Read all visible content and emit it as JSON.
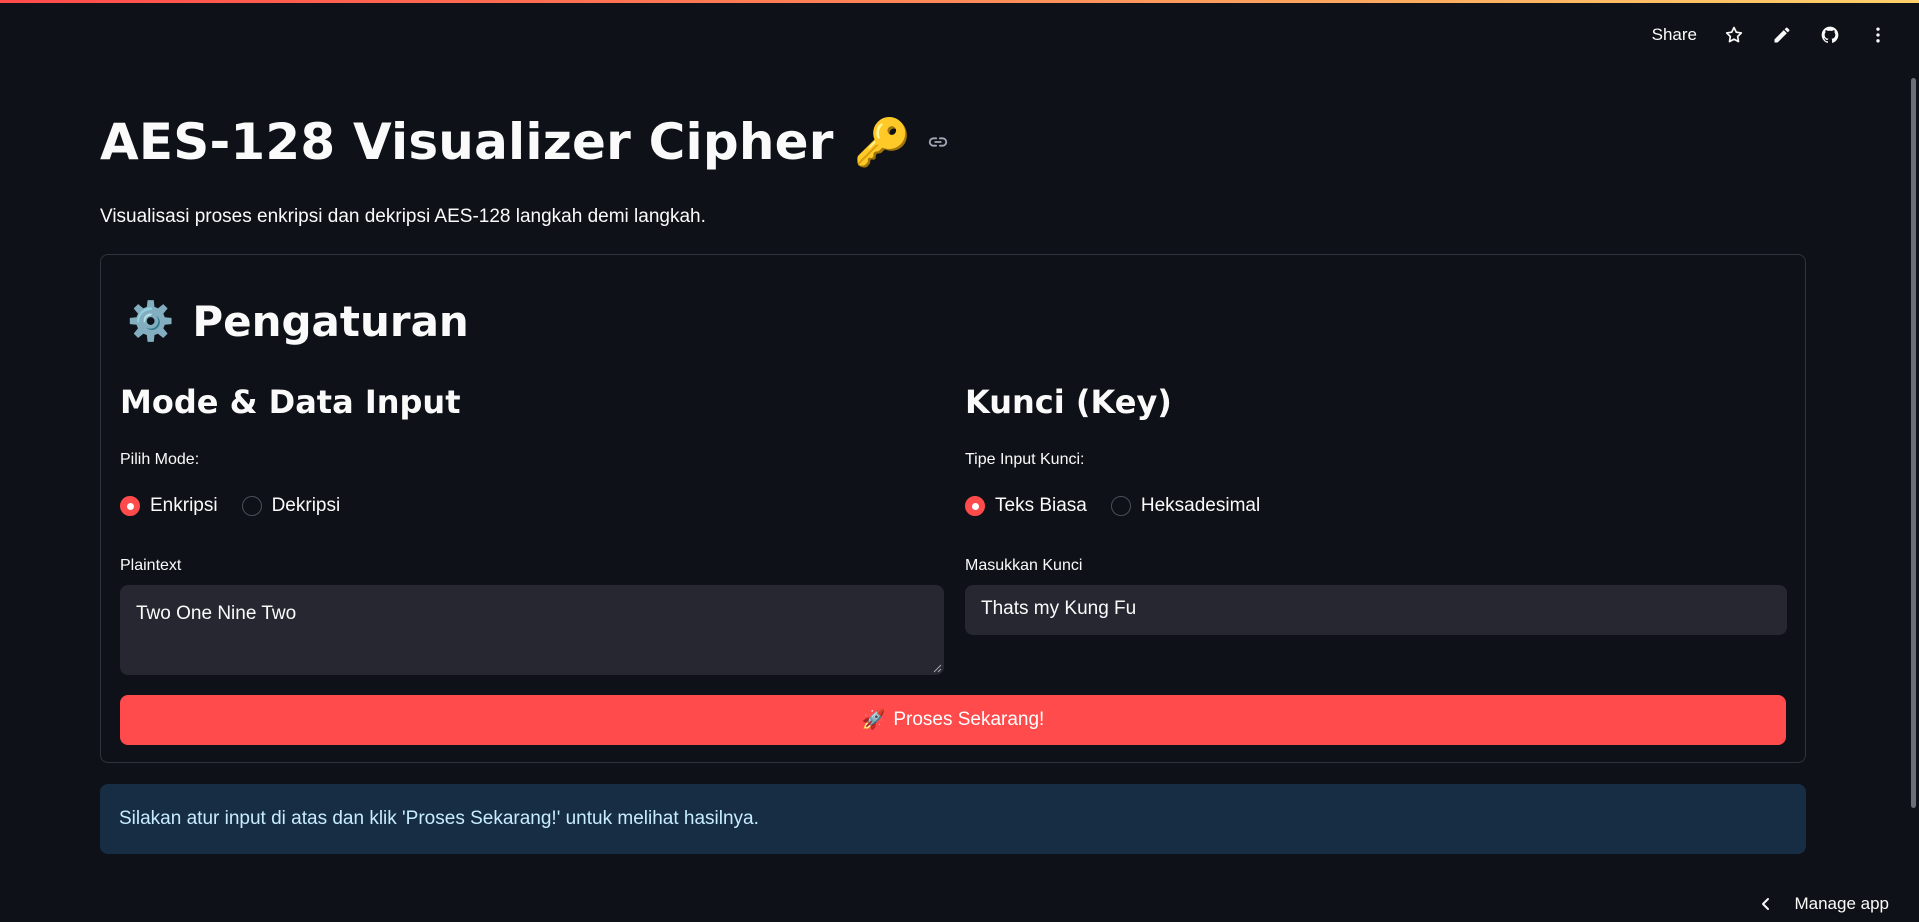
{
  "header": {
    "share_label": "Share",
    "icons": [
      "star-icon",
      "pencil-icon",
      "github-icon",
      "more-vertical-icon"
    ]
  },
  "page": {
    "title": "AES-128 Visualizer Cipher",
    "title_emoji": "🔑",
    "subtitle": "Visualisasi proses enkripsi dan dekripsi AES-128 langkah demi langkah."
  },
  "settings": {
    "emoji": "⚙️",
    "heading": "Pengaturan",
    "left": {
      "title": "Mode & Data Input",
      "mode_label": "Pilih Mode:",
      "mode_options": [
        {
          "label": "Enkripsi",
          "selected": true
        },
        {
          "label": "Dekripsi",
          "selected": false
        }
      ],
      "text_label": "Plaintext",
      "text_value": "Two One Nine Two"
    },
    "right": {
      "title": "Kunci (Key)",
      "key_type_label": "Tipe Input Kunci:",
      "key_type_options": [
        {
          "label": "Teks Biasa",
          "selected": true
        },
        {
          "label": "Heksadesimal",
          "selected": false
        }
      ],
      "key_label": "Masukkan Kunci",
      "key_value": "Thats my Kung Fu"
    },
    "button_emoji": "🚀",
    "button_label": "Proses Sekarang!"
  },
  "info": {
    "message": "Silakan atur input di atas dan klik 'Proses Sekarang!' untuk melihat hasilnya."
  },
  "footer": {
    "manage_label": "Manage app"
  },
  "colors": {
    "background": "#0e1117",
    "accent": "#ff4b4b",
    "input_bg": "#262730",
    "info_bg": "#172d43",
    "info_text": "#c7ebff"
  }
}
